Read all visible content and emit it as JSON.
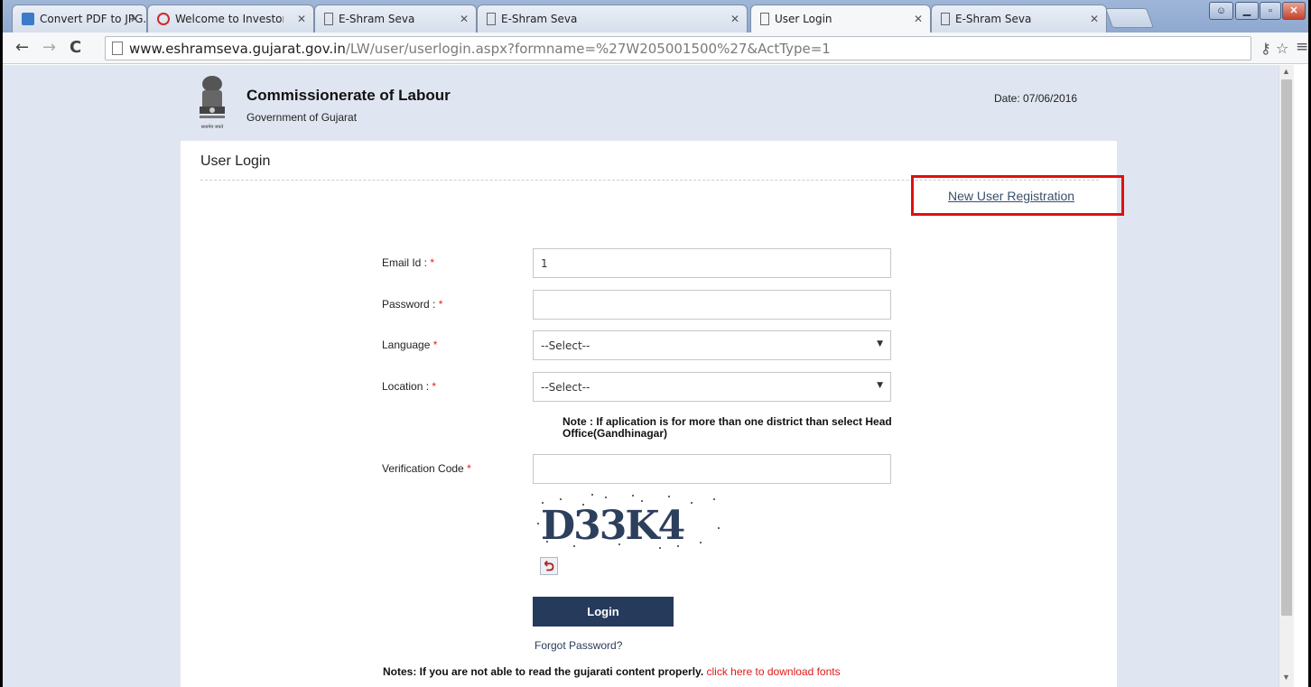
{
  "browser": {
    "tabs": [
      {
        "title": "Convert PDF to JPG... It's d",
        "icon": "converter-icon"
      },
      {
        "title": "Welcome to Investor Facili",
        "icon": "investor-facilitation-icon"
      },
      {
        "title": "E-Shram Seva",
        "icon": "page-icon"
      },
      {
        "title": "E-Shram Seva",
        "icon": "page-icon"
      },
      {
        "title": "User Login",
        "icon": "page-icon",
        "active": true
      },
      {
        "title": "E-Shram Seva",
        "icon": "page-icon"
      }
    ],
    "url_host": "www.eshramseva.gujarat.gov.in",
    "url_path": "/LW/user/userlogin.aspx?formname=%27W205001500%27&ActType=1"
  },
  "header": {
    "org_title": "Commissionerate of Labour",
    "org_subtitle": "Government of Gujarat",
    "date": "Date: 07/06/2016",
    "emblem_caption": "सत्यमेव जयते"
  },
  "form": {
    "title": "User Login",
    "new_user_link": "New User Registration",
    "email_label": "Email Id : ",
    "email_value": "1",
    "password_label": "Password : ",
    "language_label": "Language ",
    "language_value": "--Select--",
    "location_label": "Location : ",
    "location_value": "--Select--",
    "note": "Note : If aplication is for more than one district than select Head Office(Gandhinagar)",
    "verification_label": "Verification Code ",
    "captcha_text": "D33K4",
    "required_mark": "*",
    "login_button": "Login",
    "forgot_link": "Forgot Password?",
    "notes_text": "Notes: If you are not able to read the gujarati content properly.",
    "download_link": "click here to download fonts"
  },
  "colors": {
    "page_bg": "#e0e6f1",
    "login_button": "#263a5c",
    "highlight_box": "#e01010"
  }
}
